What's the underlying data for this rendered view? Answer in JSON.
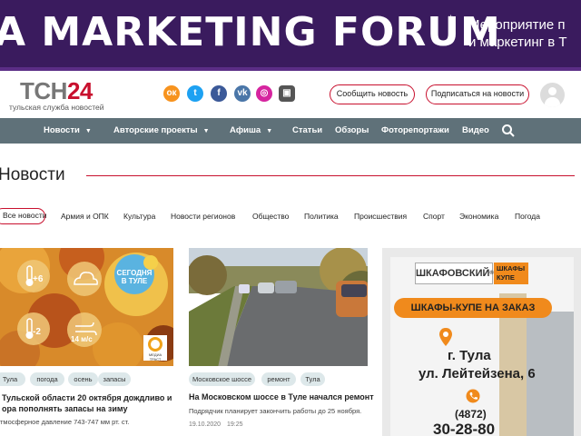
{
  "banner": {
    "title": "A MARKETING FORUM",
    "star": "*",
    "subtitle_line1": "Мероприятие п",
    "subtitle_line2": "и маркетинг в Т"
  },
  "header": {
    "logo_main": "ТСН",
    "logo_num": "24",
    "logo_sub": "тульская служба новостей",
    "social": [
      "odnoklassniki-icon",
      "twitter-icon",
      "facebook-icon",
      "vk-icon",
      "instagram-icon",
      "rss-icon"
    ],
    "report_news": "Сообщить новость",
    "subscribe": "Подписаться на новости"
  },
  "nav": {
    "items": [
      "Новости",
      "Авторские проекты",
      "Афиша",
      "Статьи",
      "Обзоры",
      "Фоторепортажи",
      "Видео"
    ]
  },
  "section": {
    "title": "Новости"
  },
  "categories": [
    "Все новости",
    "Армия и ОПК",
    "Культура",
    "Новости регионов",
    "Общество",
    "Политика",
    "Происшествия",
    "Спорт",
    "Экономика",
    "Погода"
  ],
  "cards": [
    {
      "weather_badge_line1": "СЕГОДНЯ",
      "weather_badge_line2": "В ТУЛЕ",
      "temp_day": "+6",
      "temp_night": "-2",
      "wind": "14 м/с",
      "media_badge": "МЕДИА ТРАСТ",
      "tags": [
        "Тула",
        "погода",
        "осень",
        "запасы"
      ],
      "title_line1": "Тульской области 20 октября дождливо и",
      "title_line2": "ора пополнять запасы на зиму",
      "desc": "тмосферное давление 743-747 мм рт. ст."
    },
    {
      "tags": [
        "Московское шоссе",
        "ремонт",
        "Тула"
      ],
      "title": "На Московском шоссе в Туле начался ремонт",
      "desc": "Подрядчик планирует закончить работы до 25 ноября.",
      "date": "19.10.2020",
      "time": "19:25"
    }
  ],
  "ad": {
    "brand": "ШКАФОВСКИЙ",
    "brand_mark": "®",
    "brand_right": "ШКАФЫ КУПЕ",
    "slogan": "ШКАФЫ-КУПЕ НА ЗАКАЗ",
    "city": "г. Тула",
    "address": "ул. Лейтейзена, 6",
    "phone_code": "(4872)",
    "phone": "30-28-80"
  },
  "colors": {
    "brand_red": "#c8102e",
    "nav_bg": "#5f7179",
    "banner_bg": "#3a1b5e"
  }
}
